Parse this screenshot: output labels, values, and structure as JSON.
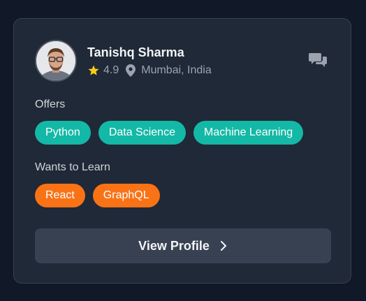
{
  "profile": {
    "name": "Tanishq Sharma",
    "rating": "4.9",
    "location": "Mumbai, India"
  },
  "offers": {
    "label": "Offers",
    "tags": [
      "Python",
      "Data Science",
      "Machine Learning"
    ]
  },
  "wants": {
    "label": "Wants to Learn",
    "tags": [
      "React",
      "GraphQL"
    ]
  },
  "actions": {
    "view_profile": "View Profile"
  },
  "icons": {
    "star": "star-icon",
    "location": "map-pin-icon",
    "chat": "chat-bubbles-icon",
    "chevron": "chevron-right-icon"
  },
  "colors": {
    "background": "#111827",
    "card": "#1f2937",
    "offer_tag": "#14b8a6",
    "learn_tag": "#f97316",
    "star": "#facc15",
    "button": "#374151"
  }
}
